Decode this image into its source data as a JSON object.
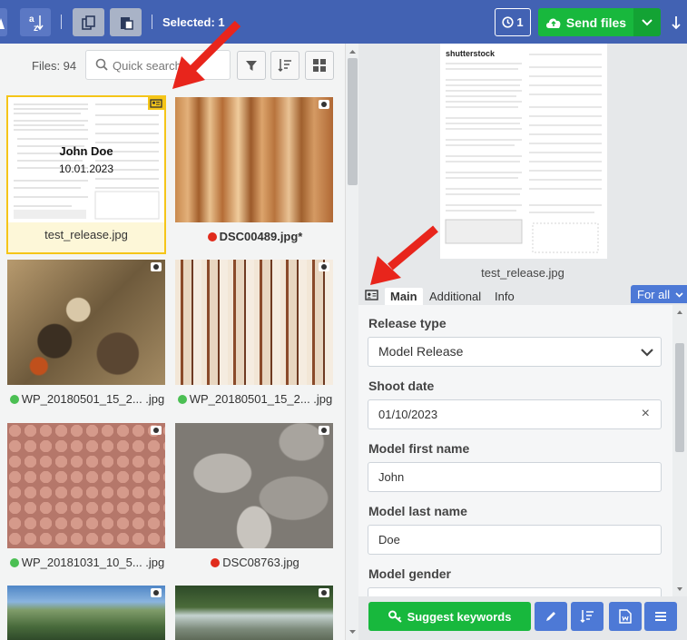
{
  "toolbar": {
    "selected_label": "Selected: 1",
    "history_count": "1",
    "send_label": "Send files",
    "sort_az_label": "a\nz"
  },
  "files": {
    "count_label": "Files: 94",
    "search_placeholder": "Quick search"
  },
  "thumbnails": [
    {
      "name": "test_release.jpg",
      "status": "",
      "overlay_name": "John Doe",
      "overlay_date": "10.01.2023"
    },
    {
      "name": "DSC00489.jpg*",
      "status": "red"
    },
    {
      "name": "WP_20180501_15_2... .jpg",
      "status": "green"
    },
    {
      "name": "WP_20180501_15_2... .jpg",
      "status": "green"
    },
    {
      "name": "WP_20181031_10_5... .jpg",
      "status": "green"
    },
    {
      "name": "DSC08763.jpg",
      "status": "red"
    }
  ],
  "preview": {
    "filename": "test_release.jpg",
    "brand": "shutterstock"
  },
  "tabs": {
    "main": "Main",
    "additional": "Additional",
    "info": "Info",
    "scope": "For all"
  },
  "form": {
    "release_type_label": "Release type",
    "release_type_value": "Model Release",
    "shoot_date_label": "Shoot date",
    "shoot_date_value": "01/10/2023",
    "first_name_label": "Model first name",
    "first_name_value": "John",
    "last_name_label": "Model last name",
    "last_name_value": "Doe",
    "gender_label": "Model gender"
  },
  "actions": {
    "suggest_label": "Suggest keywords"
  },
  "colors": {
    "toolbar": "#4262b3",
    "accent_green": "#18b83d",
    "accent_blue": "#4d79d6",
    "status_red": "#e02b1c",
    "status_green": "#4bbf53",
    "annotation_arrow": "#e8251c"
  }
}
